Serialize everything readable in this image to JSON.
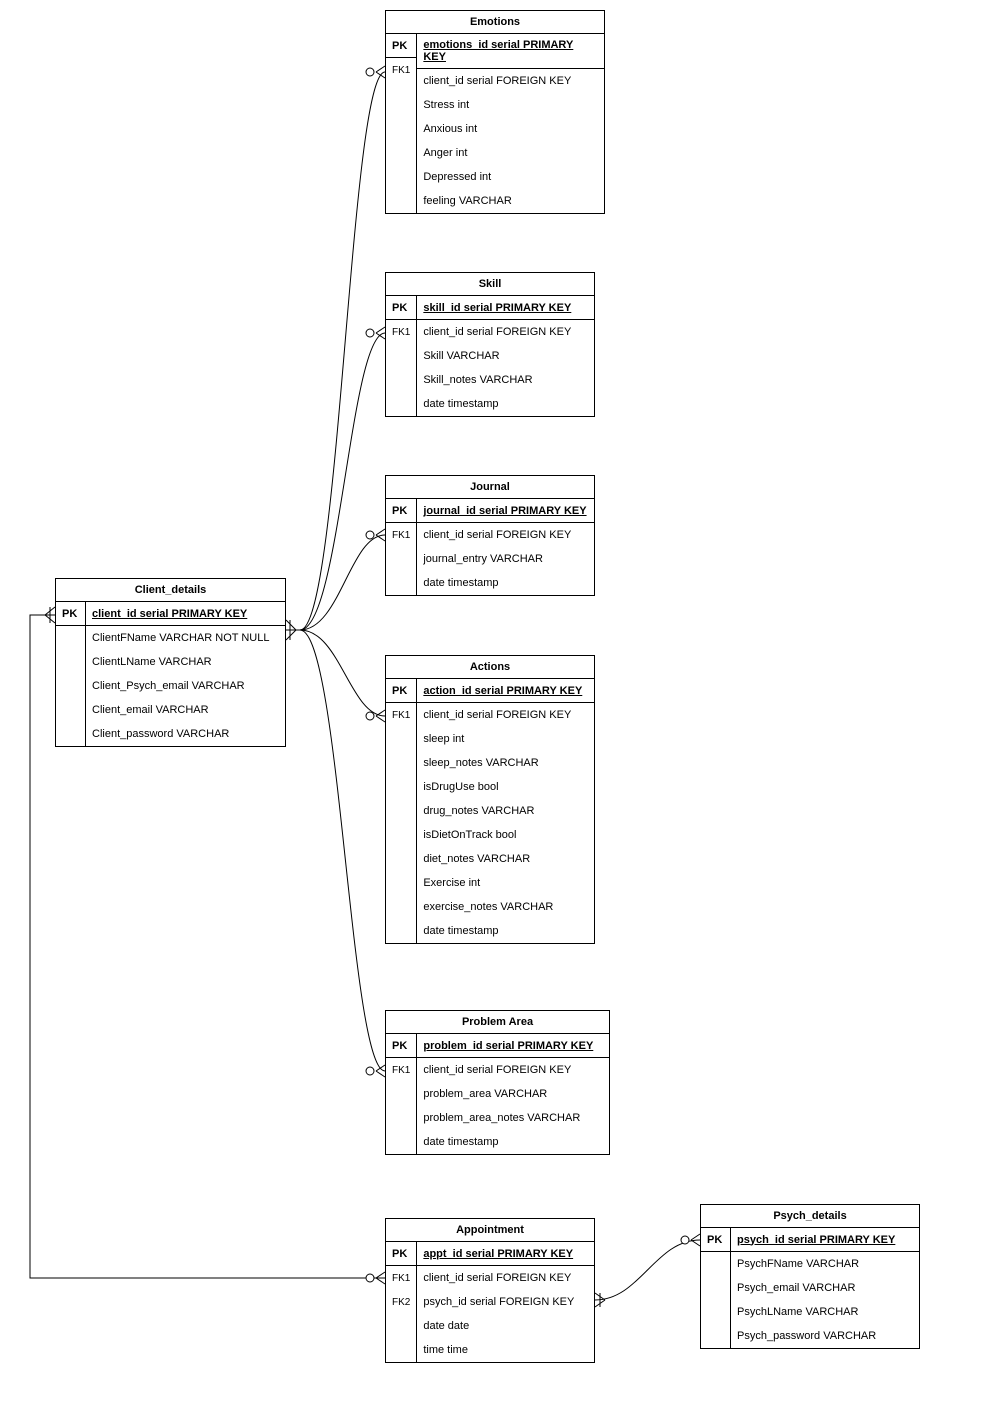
{
  "entities": {
    "client_details": {
      "title": "Client_details",
      "pk_key": "PK",
      "pk_label": "client_id serial PRIMARY KEY",
      "rows": [
        {
          "key": "",
          "label": "ClientFName VARCHAR NOT NULL"
        },
        {
          "key": "",
          "label": "ClientLName VARCHAR"
        },
        {
          "key": "",
          "label": "Client_Psych_email VARCHAR"
        },
        {
          "key": "",
          "label": "Client_email VARCHAR"
        },
        {
          "key": "",
          "label": "Client_password VARCHAR"
        }
      ]
    },
    "emotions": {
      "title": "Emotions",
      "pk_key": "PK",
      "pk_label": "emotions_id serial PRIMARY KEY",
      "rows": [
        {
          "key": "FK1",
          "label": "client_id serial FOREIGN KEY"
        },
        {
          "key": "",
          "label": "Stress int"
        },
        {
          "key": "",
          "label": "Anxious int"
        },
        {
          "key": "",
          "label": "Anger int"
        },
        {
          "key": "",
          "label": "Depressed int"
        },
        {
          "key": "",
          "label": "feeling VARCHAR"
        }
      ]
    },
    "skill": {
      "title": "Skill",
      "pk_key": "PK",
      "pk_label": "skill_id serial PRIMARY KEY",
      "rows": [
        {
          "key": "FK1",
          "label": "client_id serial FOREIGN KEY"
        },
        {
          "key": "",
          "label": "Skill VARCHAR"
        },
        {
          "key": "",
          "label": "Skill_notes VARCHAR"
        },
        {
          "key": "",
          "label": "date timestamp"
        }
      ]
    },
    "journal": {
      "title": "Journal",
      "pk_key": "PK",
      "pk_label": "journal_id serial PRIMARY KEY",
      "rows": [
        {
          "key": "FK1",
          "label": "client_id serial FOREIGN KEY"
        },
        {
          "key": "",
          "label": "journal_entry VARCHAR"
        },
        {
          "key": "",
          "label": "date timestamp"
        }
      ]
    },
    "actions": {
      "title": "Actions",
      "pk_key": "PK",
      "pk_label": "action_id serial PRIMARY KEY",
      "rows": [
        {
          "key": "FK1",
          "label": "client_id serial FOREIGN KEY"
        },
        {
          "key": "",
          "label": "sleep int"
        },
        {
          "key": "",
          "label": "sleep_notes VARCHAR"
        },
        {
          "key": "",
          "label": "isDrugUse bool"
        },
        {
          "key": "",
          "label": "drug_notes VARCHAR"
        },
        {
          "key": "",
          "label": "isDietOnTrack bool"
        },
        {
          "key": "",
          "label": "diet_notes VARCHAR"
        },
        {
          "key": "",
          "label": "Exercise int"
        },
        {
          "key": "",
          "label": "exercise_notes VARCHAR"
        },
        {
          "key": "",
          "label": "date timestamp"
        }
      ]
    },
    "problem_area": {
      "title": "Problem Area",
      "pk_key": "PK",
      "pk_label": "problem_id serial PRIMARY KEY",
      "rows": [
        {
          "key": "FK1",
          "label": "client_id serial FOREIGN KEY"
        },
        {
          "key": "",
          "label": "problem_area VARCHAR"
        },
        {
          "key": "",
          "label": "problem_area_notes VARCHAR"
        },
        {
          "key": "",
          "label": "date timestamp"
        }
      ]
    },
    "appointment": {
      "title": "Appointment",
      "pk_key": "PK",
      "pk_label": "appt_id serial PRIMARY KEY",
      "rows": [
        {
          "key": "FK1",
          "label": "client_id serial FOREIGN KEY"
        },
        {
          "key": "FK2",
          "label": "psych_id serial FOREIGN KEY"
        },
        {
          "key": "",
          "label": "date date"
        },
        {
          "key": "",
          "label": "time time"
        }
      ]
    },
    "psych_details": {
      "title": "Psych_details",
      "pk_key": "PK",
      "pk_label": "psych_id serial PRIMARY KEY",
      "rows": [
        {
          "key": "",
          "label": "PsychFName VARCHAR"
        },
        {
          "key": "",
          "label": "Psych_email VARCHAR"
        },
        {
          "key": "",
          "label": "PsychLName VARCHAR"
        },
        {
          "key": "",
          "label": "Psych_password VARCHAR"
        }
      ]
    }
  }
}
